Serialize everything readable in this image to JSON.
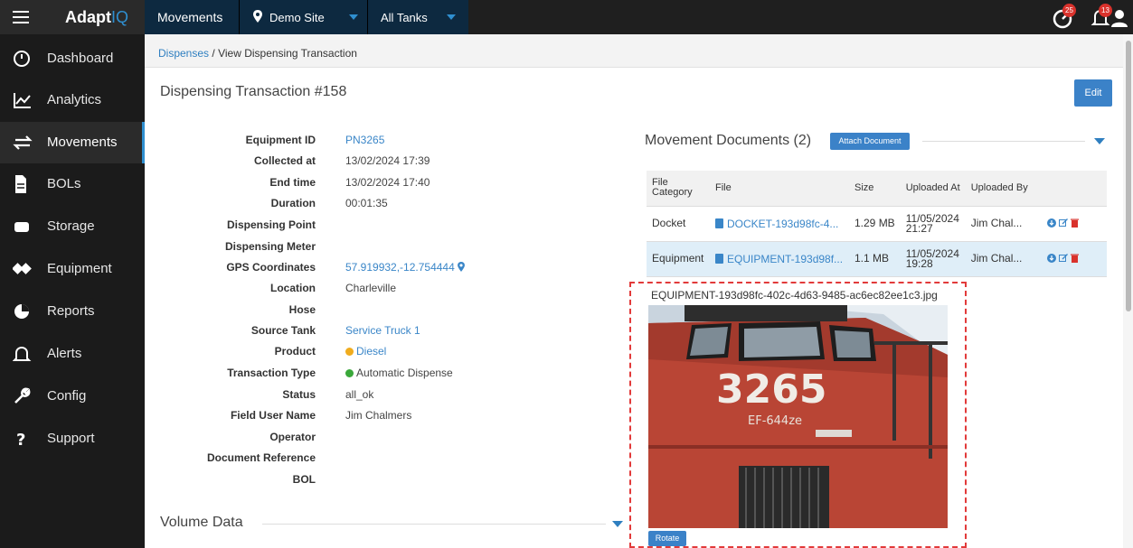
{
  "topbar": {
    "brand_main": "Adapt",
    "brand_accent": "IQ",
    "nav_movements": "Movements",
    "site": "Demo Site",
    "tanks": "All Tanks",
    "notifications_a": "25",
    "notifications_b": "13",
    "accent_color": "#2f8fd0"
  },
  "sidebar": {
    "items": [
      {
        "label": "Dashboard",
        "icon": "dashboard-icon"
      },
      {
        "label": "Analytics",
        "icon": "line-chart-icon"
      },
      {
        "label": "Movements",
        "icon": "exchange-arrows-icon",
        "active": true
      },
      {
        "label": "BOLs",
        "icon": "document-icon"
      },
      {
        "label": "Storage",
        "icon": "tank-icon"
      },
      {
        "label": "Equipment",
        "icon": "equipment-icon"
      },
      {
        "label": "Reports",
        "icon": "pie-chart-icon"
      },
      {
        "label": "Alerts",
        "icon": "bell-icon"
      },
      {
        "label": "Config",
        "icon": "wrench-icon"
      },
      {
        "label": "Support",
        "icon": "question-icon"
      }
    ]
  },
  "breadcrumb": {
    "parent": "Dispenses",
    "separator": "/",
    "current": "View Dispensing Transaction"
  },
  "page": {
    "title": "Dispensing Transaction #158",
    "edit_label": "Edit"
  },
  "details": {
    "labels": [
      "Equipment ID",
      "Collected at",
      "End time",
      "Duration",
      "Dispensing Point",
      "Dispensing Meter",
      "GPS Coordinates",
      "Location",
      "Hose",
      "Source Tank",
      "Product",
      "Transaction Type",
      "Status",
      "Field User Name",
      "Operator",
      "Document Reference",
      "BOL"
    ],
    "equipment_id": "PN3265",
    "collected_at": "13/02/2024 17:39",
    "end_time": "13/02/2024 17:40",
    "duration": "00:01:35",
    "gps": "57.919932,-12.754444",
    "location": "Charleville",
    "source_tank": "Service Truck 1",
    "product": "Diesel",
    "transaction_type": "Automatic Dispense",
    "status": "all_ok",
    "field_user": "Jim Chalmers",
    "product_color": "#f0ac1e",
    "transaction_color": "#3aa83a"
  },
  "volume": {
    "title": "Volume Data"
  },
  "documents": {
    "title": "Movement Documents (2)",
    "attach_label": "Attach Document",
    "headers": [
      "File Category",
      "File",
      "Size",
      "Uploaded At",
      "Uploaded By"
    ],
    "rows": [
      {
        "category": "Docket",
        "file": "DOCKET-193d98fc-4...",
        "size": "1.29 MB",
        "uploaded_at": "11/05/2024 21:27",
        "uploaded_by": "Jim Chal..."
      },
      {
        "category": "Equipment",
        "file": "EQUIPMENT-193d98f...",
        "size": "1.1 MB",
        "uploaded_at": "11/05/2024 19:28",
        "uploaded_by": "Jim Chal..."
      }
    ]
  },
  "preview": {
    "filename": "EQUIPMENT-193d98fc-402c-4d63-9485-ac6ec82ee1c3.jpg",
    "rotate_label": "Rotate",
    "photo_number": "3265",
    "photo_plate": "EF-644ze"
  }
}
